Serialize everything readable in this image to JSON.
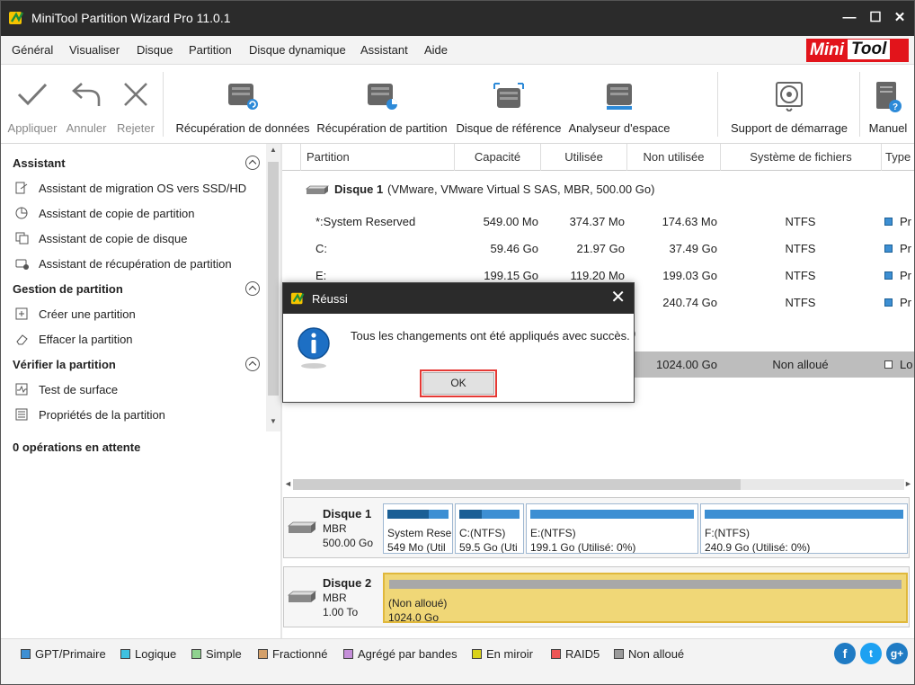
{
  "window": {
    "title": "MiniTool Partition Wizard Pro 11.0.1",
    "minimize": "—",
    "maximize": "☐",
    "close": "✕"
  },
  "brand": {
    "mini": "Mini",
    "tool": "Tool",
    "color": "#e2141b"
  },
  "menu": [
    "Général",
    "Visualiser",
    "Disque",
    "Partition",
    "Disque dynamique",
    "Assistant",
    "Aide"
  ],
  "toolbar": {
    "apply": "Appliquer",
    "undo": "Annuler",
    "discard": "Rejeter",
    "data_recovery": "Récupération de données",
    "partition_recovery": "Récupération de partition",
    "benchmark": "Disque de référence",
    "space_analyzer": "Analyseur d'espace",
    "bootable_media": "Support de démarrage",
    "manual": "Manuel"
  },
  "sidebar": {
    "wizard_title": "Assistant",
    "wizard_items": [
      "Assistant de migration OS vers SSD/HD",
      "Assistant de copie de partition",
      "Assistant de copie de disque",
      "Assistant de récupération de partition"
    ],
    "partition_title": "Gestion de partition",
    "partition_items": [
      "Créer une partition",
      "Effacer la partition"
    ],
    "check_title": "Vérifier la partition",
    "check_items": [
      "Test de surface",
      "Propriétés de la partition"
    ],
    "pending": "0 opérations en attente"
  },
  "grid": {
    "headers": [
      "Partition",
      "Capacité",
      "Utilisée",
      "Non utilisée",
      "Système de fichiers",
      "Type"
    ],
    "disk1_label": "Disque 1",
    "disk1_desc": "(VMware, VMware Virtual S SAS, MBR, 500.00 Go)",
    "rows": [
      {
        "partition": "*:System Reserved",
        "capacity": "549.00 Mo",
        "used": "374.37 Mo",
        "unused": "174.63 Mo",
        "fs": "NTFS",
        "type": "Pr"
      },
      {
        "partition": "C:",
        "capacity": "59.46 Go",
        "used": "21.97 Go",
        "unused": "37.49 Go",
        "fs": "NTFS",
        "type": "Pr"
      },
      {
        "partition": "E:",
        "capacity": "199.15 Go",
        "used": "119.20 Mo",
        "unused": "199.03 Go",
        "fs": "NTFS",
        "type": "Pr"
      },
      {
        "partition": "",
        "capacity": "",
        "used": "",
        "unused": "240.74 Go",
        "fs": "NTFS",
        "type": "Pr"
      }
    ],
    "disk2_partial": ")",
    "selected_row": {
      "unused": "1024.00 Go",
      "fs": "Non alloué",
      "type": "Lo"
    }
  },
  "diskmap": {
    "disk1": {
      "name": "Disque 1",
      "scheme": "MBR",
      "size": "500.00 Go",
      "parts": [
        {
          "l1": "System Rese",
          "l2": "549 Mo (Util",
          "used": 0.68
        },
        {
          "l1": "C:(NTFS)",
          "l2": "59.5 Go (Uti",
          "used": 0.37
        },
        {
          "l1": "E:(NTFS)",
          "l2": "199.1 Go (Utilisé: 0%)",
          "used": 0.0
        },
        {
          "l1": "F:(NTFS)",
          "l2": "240.9 Go (Utilisé: 0%)",
          "used": 0.0
        }
      ]
    },
    "disk2": {
      "name": "Disque 2",
      "scheme": "MBR",
      "size": "1.00 To",
      "l1": "(Non alloué)",
      "l2": "1024.0 Go"
    }
  },
  "legend": [
    {
      "label": "GPT/Primaire",
      "color": "#3d8fd3"
    },
    {
      "label": "Logique",
      "color": "#3fc1e0"
    },
    {
      "label": "Simple",
      "color": "#8fd28f"
    },
    {
      "label": "Fractionné",
      "color": "#d4a06a"
    },
    {
      "label": "Agrégé par bandes",
      "color": "#c58fd9"
    },
    {
      "label": "En miroir",
      "color": "#d9d21a"
    },
    {
      "label": "RAID5",
      "color": "#ee5555"
    },
    {
      "label": "Non alloué",
      "color": "#9a9a9a"
    }
  ],
  "social": {
    "facebook": "f",
    "twitter": "t",
    "google": "g+"
  },
  "dialog": {
    "title": "Réussi",
    "message": "Tous les changements ont été appliqués avec succès.",
    "ok": "OK",
    "close": "✕"
  }
}
